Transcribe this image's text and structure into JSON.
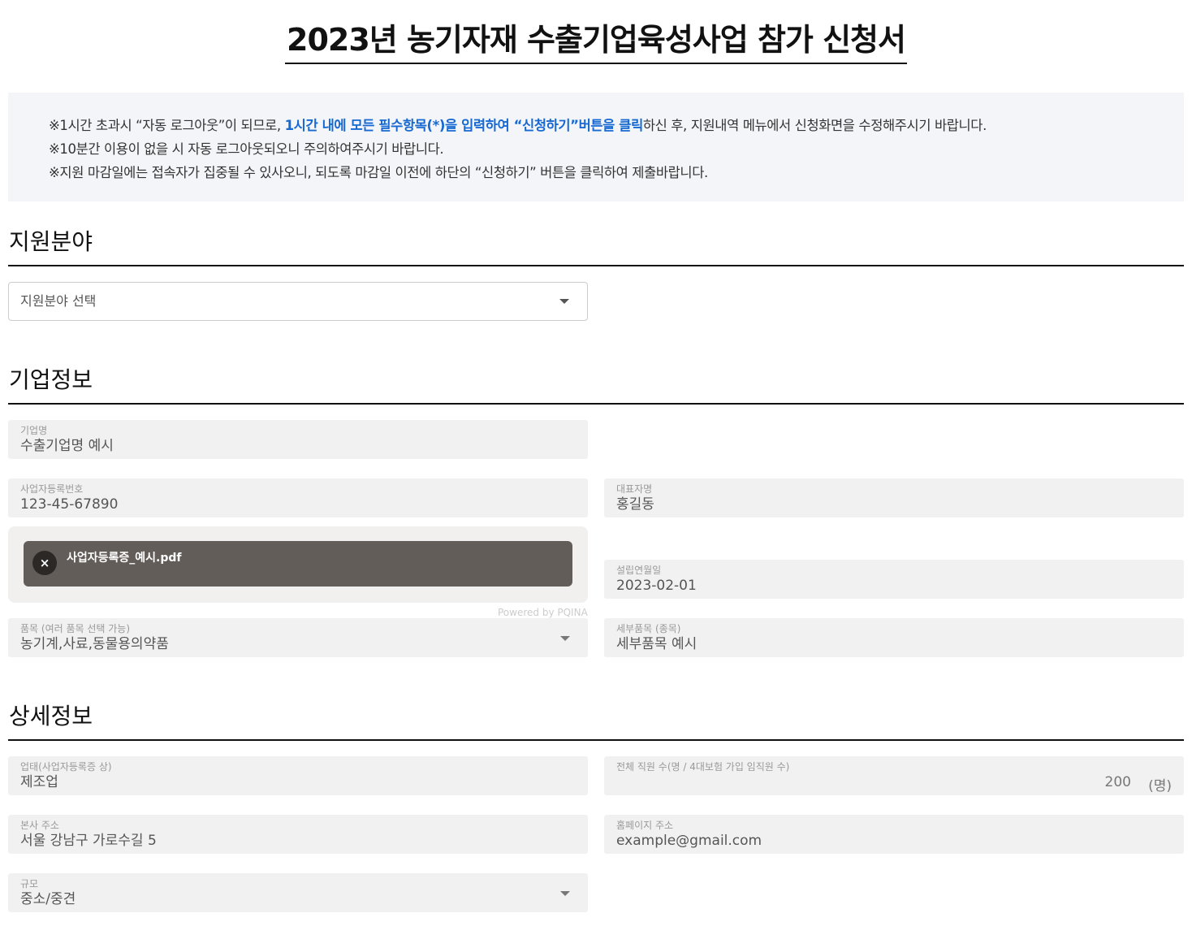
{
  "page": {
    "title": "2023년 농기자재 수출기업육성사업 참가 신청서"
  },
  "notice": {
    "line1_prefix": "※1시간 초과시 “자동 로그아웃”이 되므로, ",
    "line1_highlight": "1시간 내에 모든 필수항목(*)을 입력하여 “신청하기”버튼을 클릭",
    "line1_suffix": "하신 후, 지원내역 메뉴에서 신청화면을 수정해주시기 바랍니다.",
    "line2": "※10분간 이용이 없을 시 자동 로그아웃되오니 주의하여주시기 바랍니다.",
    "line3": "※지원 마감일에는 접속자가 집중될 수 있사오니, 되도록 마감일 이전에 하단의 “신청하기” 버튼을 클릭하여 제출바랍니다.",
    "highlight_color": "#1769d1"
  },
  "support_field": {
    "section_title": "지원분야",
    "select_placeholder": "지원분야 선택",
    "icon": "chevron-down-icon"
  },
  "company": {
    "section_title": "기업정보",
    "company_name": {
      "label": "기업명",
      "value": "수출기업명 예시"
    },
    "business_number": {
      "label": "사업자등록번호",
      "value": "123-45-67890"
    },
    "representative": {
      "label": "대표자명",
      "value": "홍길동"
    },
    "upload": {
      "file_name": "사업자등록증_예시.pdf",
      "remove_icon": "close-icon",
      "remove_glyph": "×",
      "powered_by": "Powered by PQINA"
    },
    "established": {
      "label": "설립연월일",
      "value": "2023-02-01"
    },
    "items": {
      "label": "품목 (여러 품목 선택 가능)",
      "value": "농기계,사료,동물용의약품"
    },
    "sub_items": {
      "label": "세부품목 (종목)",
      "value": "세부품목 예시"
    }
  },
  "details": {
    "section_title": "상세정보",
    "business_type": {
      "label": "업태(사업자등록증 상)",
      "value": "제조업"
    },
    "employees": {
      "label": "전체 직원 수(명 / 4대보험 가입 임직원 수)",
      "value": "200",
      "unit": "(명)"
    },
    "address": {
      "label": "본사 주소",
      "value": "서울 강남구 가로수길 5"
    },
    "homepage": {
      "label": "홈페이지 주소",
      "value": "example@gmail.com"
    },
    "scale": {
      "label": "규모",
      "value": "중소/중견"
    }
  }
}
